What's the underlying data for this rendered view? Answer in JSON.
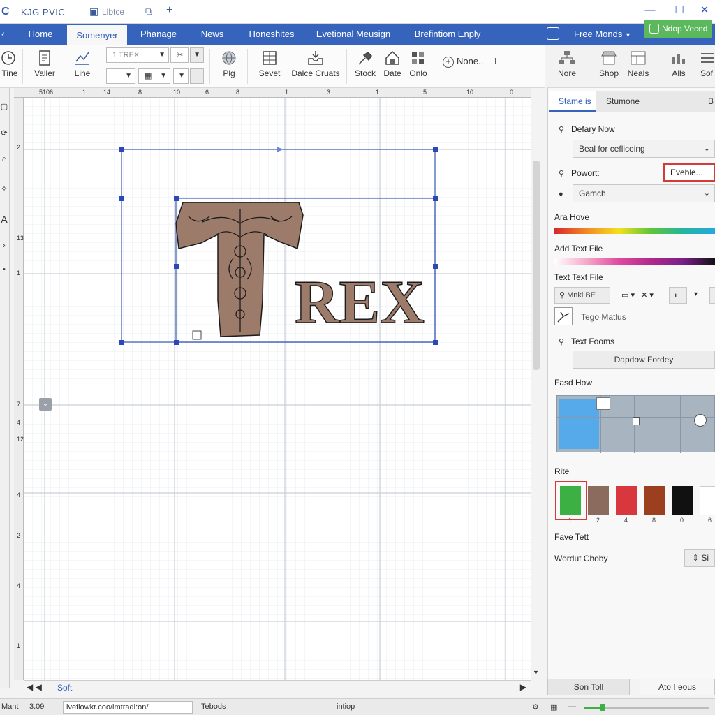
{
  "titlebar": {
    "app_title": "KJG PVIC",
    "sub_title": "Llbtce",
    "controls": [
      "minimize-icon",
      "maximize-icon",
      "close-icon"
    ]
  },
  "menubar": {
    "tabs": [
      {
        "label": "Home",
        "active": false
      },
      {
        "label": "Somenyer",
        "active": true
      },
      {
        "label": "Phanage",
        "active": false
      },
      {
        "label": "News",
        "active": false
      },
      {
        "label": "Honeshites",
        "active": false
      },
      {
        "label": "Evetional Meusign",
        "active": false
      },
      {
        "label": "Brefintiom Enply",
        "active": false
      }
    ],
    "free_monds": "Free Monds",
    "green_button": "Ndop Veced"
  },
  "ribbon": {
    "tools": [
      {
        "label": "Tine",
        "icon": "clock-icon"
      },
      {
        "label": "Valler",
        "icon": "document-icon"
      },
      {
        "label": "Line",
        "icon": "line-chart-icon"
      },
      {
        "label": "Plg",
        "icon": "globe-icon"
      },
      {
        "label": "Sevet",
        "icon": "table-icon"
      },
      {
        "label": "Dalce Cruats",
        "icon": "inbox-icon"
      },
      {
        "label": "Stock",
        "icon": "shovel-icon"
      },
      {
        "label": "Date",
        "icon": "house-icon"
      },
      {
        "label": "Onlo",
        "icon": "grid-icon"
      }
    ],
    "font_combo": "1 TREX",
    "none_button": "None..",
    "right_tools": [
      {
        "label": "Nore",
        "icon": "network-icon"
      },
      {
        "label": "Shop",
        "icon": "shop-icon"
      },
      {
        "label": "Neals",
        "icon": "layout-icon"
      },
      {
        "label": "Alls",
        "icon": "chart-icon"
      },
      {
        "label": "Sof",
        "icon": "list-icon"
      }
    ]
  },
  "ruler": {
    "top": [
      "5106",
      "1",
      "14",
      "8",
      "10",
      "6",
      "8",
      "1",
      "3",
      "1",
      "5",
      "10",
      "0"
    ],
    "left": [
      "2",
      "13",
      "1",
      "7",
      "4",
      "12",
      "4",
      "2",
      "4",
      "1"
    ]
  },
  "canvas": {
    "logo_letter": "T",
    "logo_rest": "REX"
  },
  "hscroll": {
    "label": "Soft"
  },
  "panel": {
    "tabs": [
      {
        "label": "Stame is",
        "active": true
      },
      {
        "label": "Stumone",
        "active": false
      },
      {
        "label": "B",
        "active": false
      }
    ],
    "defary_now": "Defary Now",
    "select1": "Beal for cefliceing",
    "powort": "Powort:",
    "eveble_button": "Eveble...",
    "select2": "Gamch",
    "ara_hove": "Ara Hove",
    "add_text_file": "Add Text File",
    "text_text_file": "Text Text File",
    "font_btn": "Mnki BE",
    "tego_label": "Tego Matlus",
    "text_fooms": "Text Fooms",
    "dapdow_button": "Dapdow Fordey",
    "fasd_how": "Fasd How",
    "rite": "Rite",
    "swatches": [
      {
        "color": "#3cb043",
        "num": "1"
      },
      {
        "color": "#8b6b5d",
        "num": "2"
      },
      {
        "color": "#d8373d",
        "num": "4"
      },
      {
        "color": "#9b3f1f",
        "num": "8"
      },
      {
        "color": "#111111",
        "num": "0"
      },
      {
        "color": "#ffffff",
        "num": "6"
      }
    ],
    "fave_tett": "Fave Tett",
    "wordut_choby": "Wordut Choby",
    "small_btn": "Si",
    "bottom_left": "Son Toll",
    "bottom_right": "Ato I eous"
  },
  "statusbar": {
    "left": "Mant",
    "value": "3.09",
    "input": "lvefiowkr.coo/imtradi:on/",
    "tebods": "Tebods",
    "center": "intiop",
    "zoom_percent": 15
  }
}
